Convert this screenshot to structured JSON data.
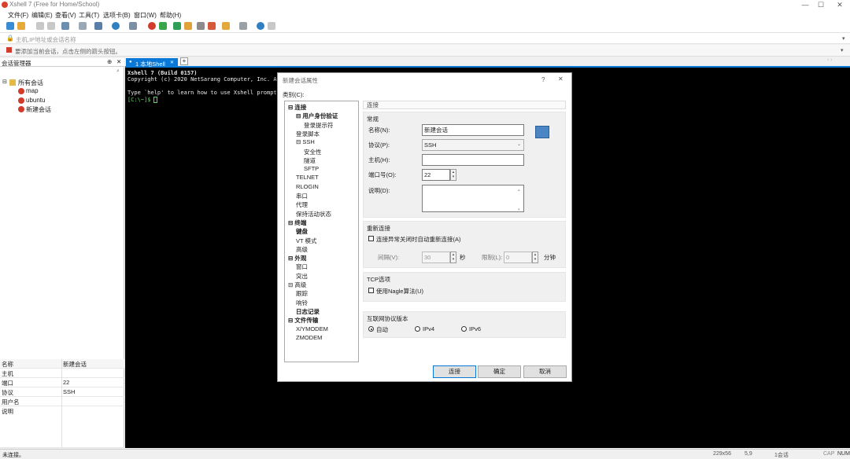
{
  "window": {
    "title": "Xshell 7 (Free for Home/School)",
    "controls": [
      "—",
      "☐",
      "✕"
    ]
  },
  "menu": [
    "文件(F)",
    "编辑(E)",
    "查看(V)",
    "工具(T)",
    "选项卡(B)",
    "窗口(W)",
    "帮助(H)"
  ],
  "address": {
    "placeholder": "主机,IP地址或会话名称"
  },
  "hint": "要添加当前会话，点击左侧的箭头按钮。",
  "session_manager": {
    "title": "会话管理器",
    "root": "所有会话",
    "items": [
      "map",
      "ubuntu",
      "新建会话"
    ]
  },
  "properties": {
    "header": [
      "名称",
      "新建会话"
    ],
    "rows": [
      [
        "主机",
        ""
      ],
      [
        "端口",
        "22"
      ],
      [
        "协议",
        "SSH"
      ],
      [
        "用户名",
        ""
      ],
      [
        "说明",
        ""
      ]
    ]
  },
  "tab": {
    "label": "1 本地Shell"
  },
  "terminal": {
    "lines": [
      "Xshell 7 (Build 0157)",
      "Copyright (c) 2020 NetSarang Computer, Inc. All",
      "",
      "Type `help' to learn how to use Xshell prompt."
    ],
    "prompt": "[C:\\~]$ "
  },
  "status": {
    "left": "未连接。",
    "size": "229x56",
    "pos": "5,9",
    "sessions": "1会话",
    "caps": "CAP",
    "num": "NUM"
  },
  "dialog": {
    "title": "新建会话属性",
    "help": "?",
    "close": "✕",
    "category_label": "类别(C):",
    "tree": [
      {
        "t": "⊟ 连接",
        "b": true,
        "lv": 0
      },
      {
        "t": "⊟ 用户身份验证",
        "b": true,
        "lv": 1
      },
      {
        "t": "登录提示符",
        "b": false,
        "lv": 2
      },
      {
        "t": "登录脚本",
        "b": false,
        "lv": 1
      },
      {
        "t": "⊟ SSH",
        "b": false,
        "lv": 1
      },
      {
        "t": "安全性",
        "b": false,
        "lv": 2
      },
      {
        "t": "隧道",
        "b": false,
        "lv": 2
      },
      {
        "t": "SFTP",
        "b": false,
        "lv": 2
      },
      {
        "t": "TELNET",
        "b": false,
        "lv": 1
      },
      {
        "t": "RLOGIN",
        "b": false,
        "lv": 1
      },
      {
        "t": "串口",
        "b": false,
        "lv": 1
      },
      {
        "t": "代理",
        "b": false,
        "lv": 1
      },
      {
        "t": "保持活动状态",
        "b": false,
        "lv": 1
      },
      {
        "t": "⊟ 终端",
        "b": true,
        "lv": 0
      },
      {
        "t": "键盘",
        "b": true,
        "lv": 1
      },
      {
        "t": "VT 模式",
        "b": false,
        "lv": 1
      },
      {
        "t": "高级",
        "b": false,
        "lv": 1
      },
      {
        "t": "⊟ 外观",
        "b": true,
        "lv": 0
      },
      {
        "t": "窗口",
        "b": false,
        "lv": 1
      },
      {
        "t": "突出",
        "b": false,
        "lv": 1
      },
      {
        "t": "⊟ 高级",
        "b": false,
        "lv": 0
      },
      {
        "t": "跟踪",
        "b": false,
        "lv": 1
      },
      {
        "t": "响铃",
        "b": false,
        "lv": 1
      },
      {
        "t": "日志记录",
        "b": true,
        "lv": 1
      },
      {
        "t": "⊟ 文件传输",
        "b": true,
        "lv": 0
      },
      {
        "t": "X/YMODEM",
        "b": false,
        "lv": 1
      },
      {
        "t": "ZMODEM",
        "b": false,
        "lv": 1
      }
    ],
    "pane_header": "连接",
    "general": {
      "label": "常规",
      "name_label": "名称(N):",
      "name_value": "新建会话",
      "protocol_label": "协议(P):",
      "protocol_value": "SSH",
      "host_label": "主机(H):",
      "host_value": "",
      "port_label": "端口号(O):",
      "port_value": "22",
      "desc_label": "说明(D):"
    },
    "reconnect": {
      "label": "重新连接",
      "checkbox": "连接异常关闭时自动重新连接(A)",
      "interval_label": "间隔(V):",
      "interval_value": "30",
      "interval_unit": "秒",
      "limit_label": "限制(L):",
      "limit_value": "0",
      "limit_unit": "分钟"
    },
    "tcp": {
      "label": "TCP选项",
      "checkbox": "使用Nagle算法(U)"
    },
    "ipver": {
      "label": "互联网协议版本",
      "options": [
        "自动",
        "IPv4",
        "IPv6"
      ],
      "selected": "自动"
    },
    "buttons": {
      "connect": "连接",
      "ok": "确定",
      "cancel": "取消"
    }
  }
}
